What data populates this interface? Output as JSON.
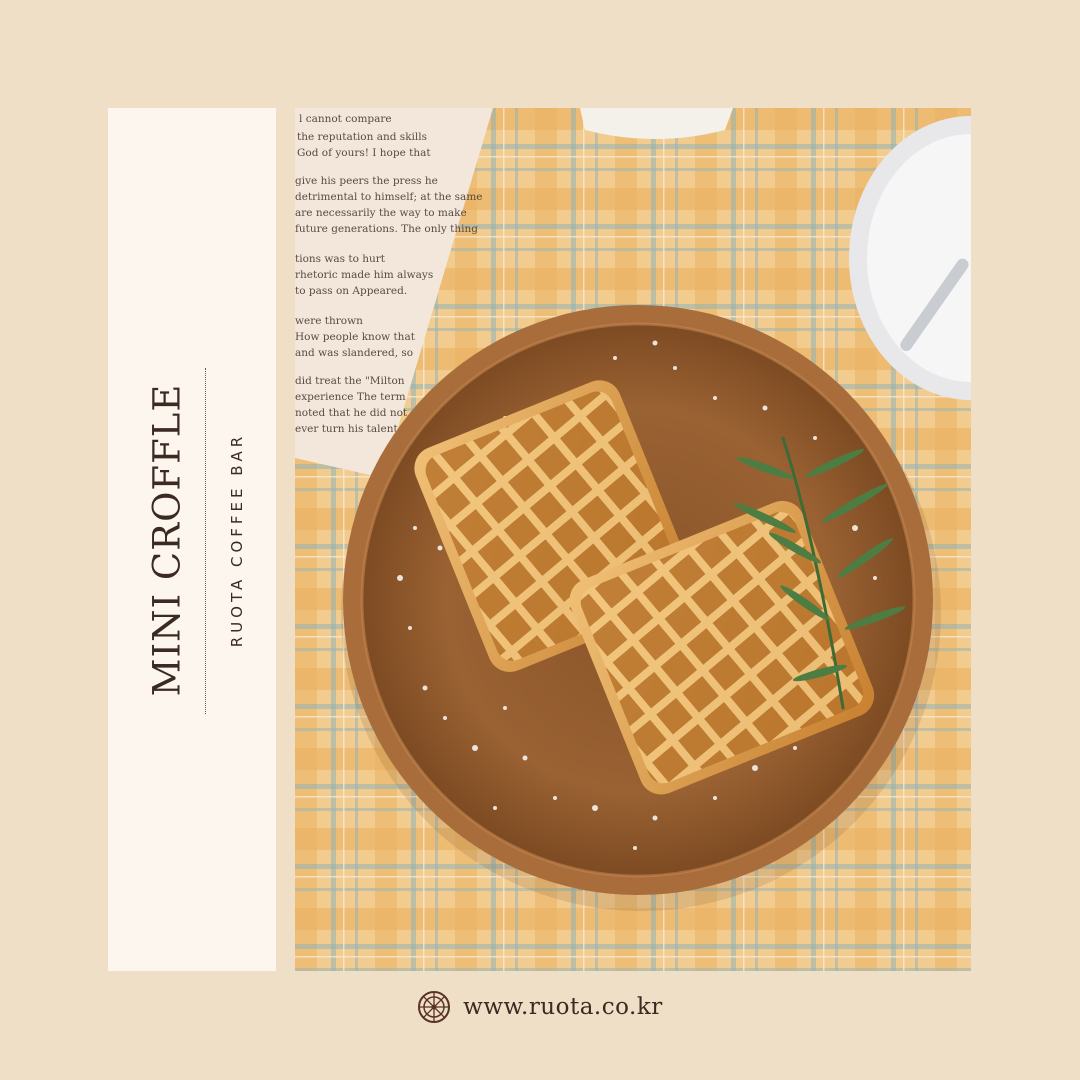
{
  "title": "MINI CROFFLE",
  "subtitle": "RUOTA COFFEE BAR",
  "website": "www.ruota.co.kr",
  "icons": {
    "logo": "wheel-icon"
  },
  "colors": {
    "background": "#efdfc6",
    "card": "#fcf6ee",
    "text": "#3b2a22",
    "plate": "#a06a3a",
    "waffle": "#d89a46"
  }
}
